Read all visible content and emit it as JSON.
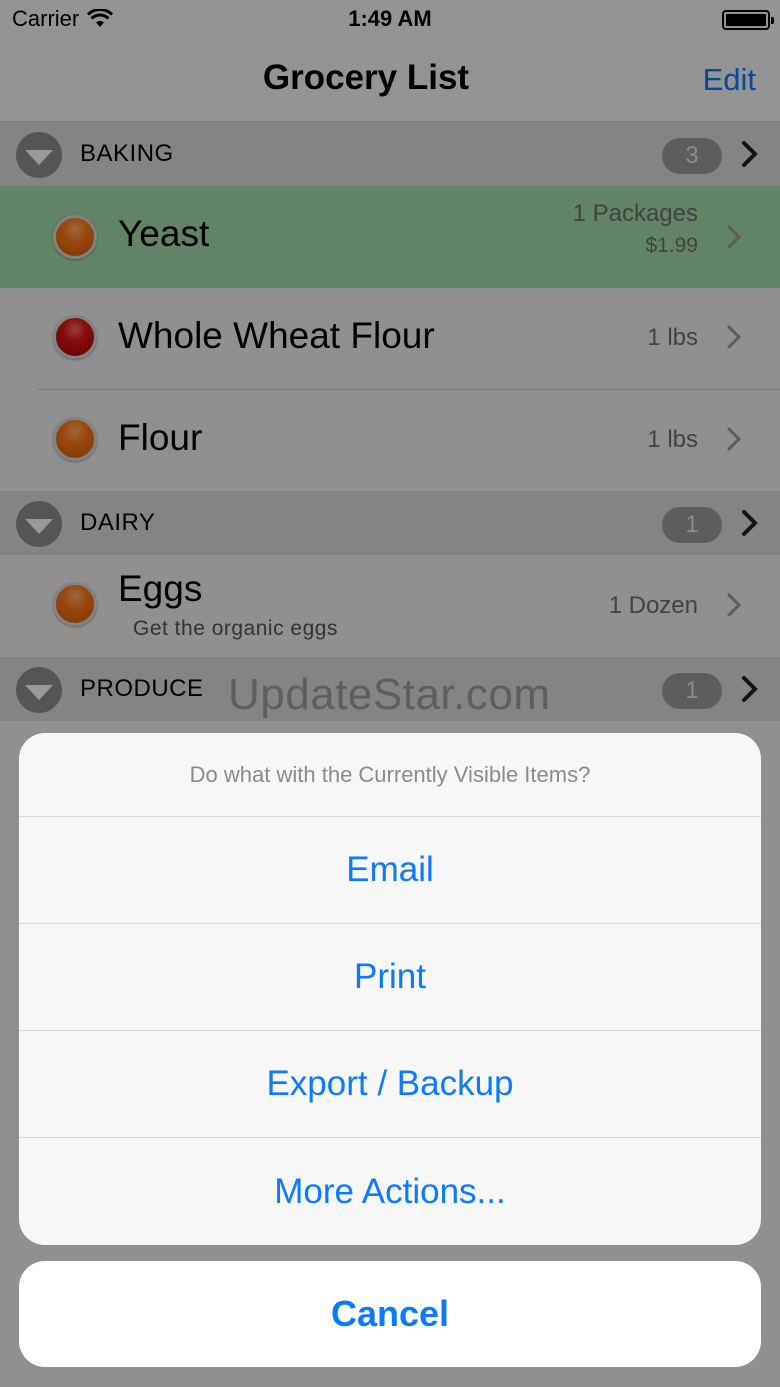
{
  "status_bar": {
    "carrier": "Carrier",
    "time": "1:49 AM"
  },
  "nav": {
    "title": "Grocery List",
    "edit_label": "Edit"
  },
  "sections": [
    {
      "title": "BAKING",
      "count": "3",
      "items": [
        {
          "name": "Yeast",
          "quantity": "1 Packages",
          "price": "$1.99",
          "color": "#ff7a1a",
          "highlighted": true
        },
        {
          "name": "Whole Wheat Flour",
          "quantity": "1 lbs",
          "color": "#e01515"
        },
        {
          "name": "Flour",
          "quantity": "1 lbs",
          "color": "#ff7a1a"
        }
      ]
    },
    {
      "title": "DAIRY",
      "count": "1",
      "items": [
        {
          "name": "Eggs",
          "note": "Get the organic eggs",
          "quantity": "1 Dozen",
          "color": "#ff7a1a"
        }
      ]
    },
    {
      "title": "PRODUCE",
      "count": "1",
      "items": []
    }
  ],
  "watermark": "UpdateStar.com",
  "action_sheet": {
    "title": "Do what with the Currently Visible Items?",
    "buttons": [
      "Email",
      "Print",
      "Export / Backup",
      "More Actions..."
    ],
    "cancel_label": "Cancel"
  },
  "colors": {
    "accent": "#0a7aff",
    "highlight_row": "#a3dcaa",
    "item_orange": "#ff7a1a",
    "item_red": "#e01515"
  }
}
